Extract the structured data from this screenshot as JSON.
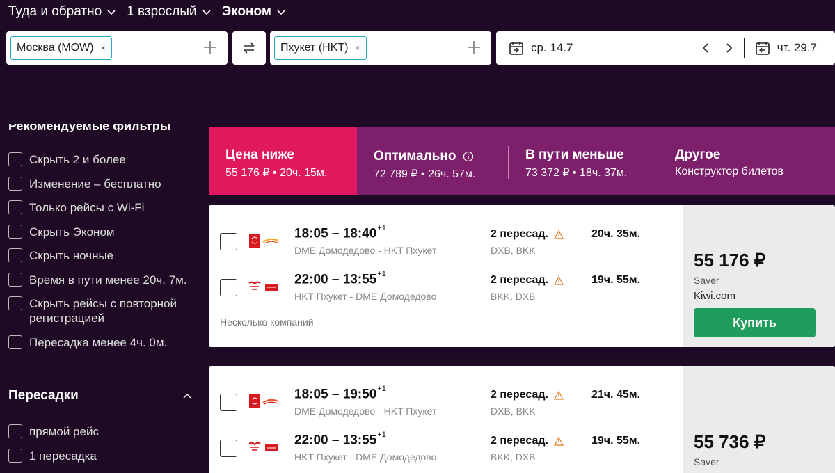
{
  "search": {
    "trip_type": "Туда и обратно",
    "passengers": "1 взрослый",
    "cabin": "Эконом",
    "origin": "Москва (MOW)",
    "destination": "Пхукет (HKT)",
    "remove_glyph": "×",
    "depart_date": "ср. 14.7",
    "return_date": "чт. 29.7"
  },
  "sidebar": {
    "recommended_title": "Рекомендуемые фильтры",
    "filters": [
      {
        "label": "Скрыть 2 и более"
      },
      {
        "label": "Изменение – бесплатно"
      },
      {
        "label": "Только рейсы с Wi-Fi"
      },
      {
        "label": "Скрыть Эконом"
      },
      {
        "label": "Скрыть ночные"
      },
      {
        "label": "Время в пути менее 20ч. 7м."
      },
      {
        "label": "Скрыть рейсы с повторной регистрацией"
      },
      {
        "label": "Пересадка менее 4ч. 0м."
      }
    ],
    "stops_title": "Пересадки",
    "stop_filters": [
      {
        "label": "прямой рейс"
      },
      {
        "label": "1 пересадка"
      }
    ]
  },
  "sort_tabs": [
    {
      "title": "Цена ниже",
      "sub": "55 176 ₽ • 20ч. 15м."
    },
    {
      "title": "Оптимально",
      "sub": "72 789 ₽ • 26ч. 57м."
    },
    {
      "title": "В пути меньше",
      "sub": "73 372 ₽ • 18ч. 37м."
    },
    {
      "title": "Другое",
      "sub": "Конструктор билетов"
    }
  ],
  "results": [
    {
      "legs": [
        {
          "times": "18:05 – 18:40",
          "plus": "+1",
          "route": "DME Домодедово - HKT Пхукет",
          "stops": "2 пересад.",
          "via": "DXB, BKK",
          "duration": "20ч. 35м."
        },
        {
          "times": "22:00 – 13:55",
          "plus": "+1",
          "route": "HKT Пхукет - DME Домодедово",
          "stops": "2 пересад.",
          "via": "BKK, DXB",
          "duration": "19ч. 55м."
        }
      ],
      "companies": "Несколько компаний",
      "price": "55 176 ₽",
      "fare": "Saver",
      "agent": "Kiwi.com",
      "buy_label": "Купить"
    },
    {
      "legs": [
        {
          "times": "18:05 – 19:50",
          "plus": "+1",
          "route": "DME Домодедово - HKT Пхукет",
          "stops": "2 пересад.",
          "via": "DXB, BKK",
          "duration": "21ч. 45м."
        },
        {
          "times": "22:00 – 13:55",
          "plus": "+1",
          "route": "HKT Пхукет - DME Домодедово",
          "stops": "2 пересад.",
          "via": "BKK, DXB",
          "duration": "19ч. 55м."
        }
      ],
      "price": "55 736 ₽",
      "fare": "Saver"
    }
  ],
  "colors": {
    "background": "#1e0a24",
    "tab_active": "#e0195f",
    "tab_bar": "#7d1f6a",
    "buy_button": "#1f9d5c",
    "chip_border": "#29a6c8"
  }
}
